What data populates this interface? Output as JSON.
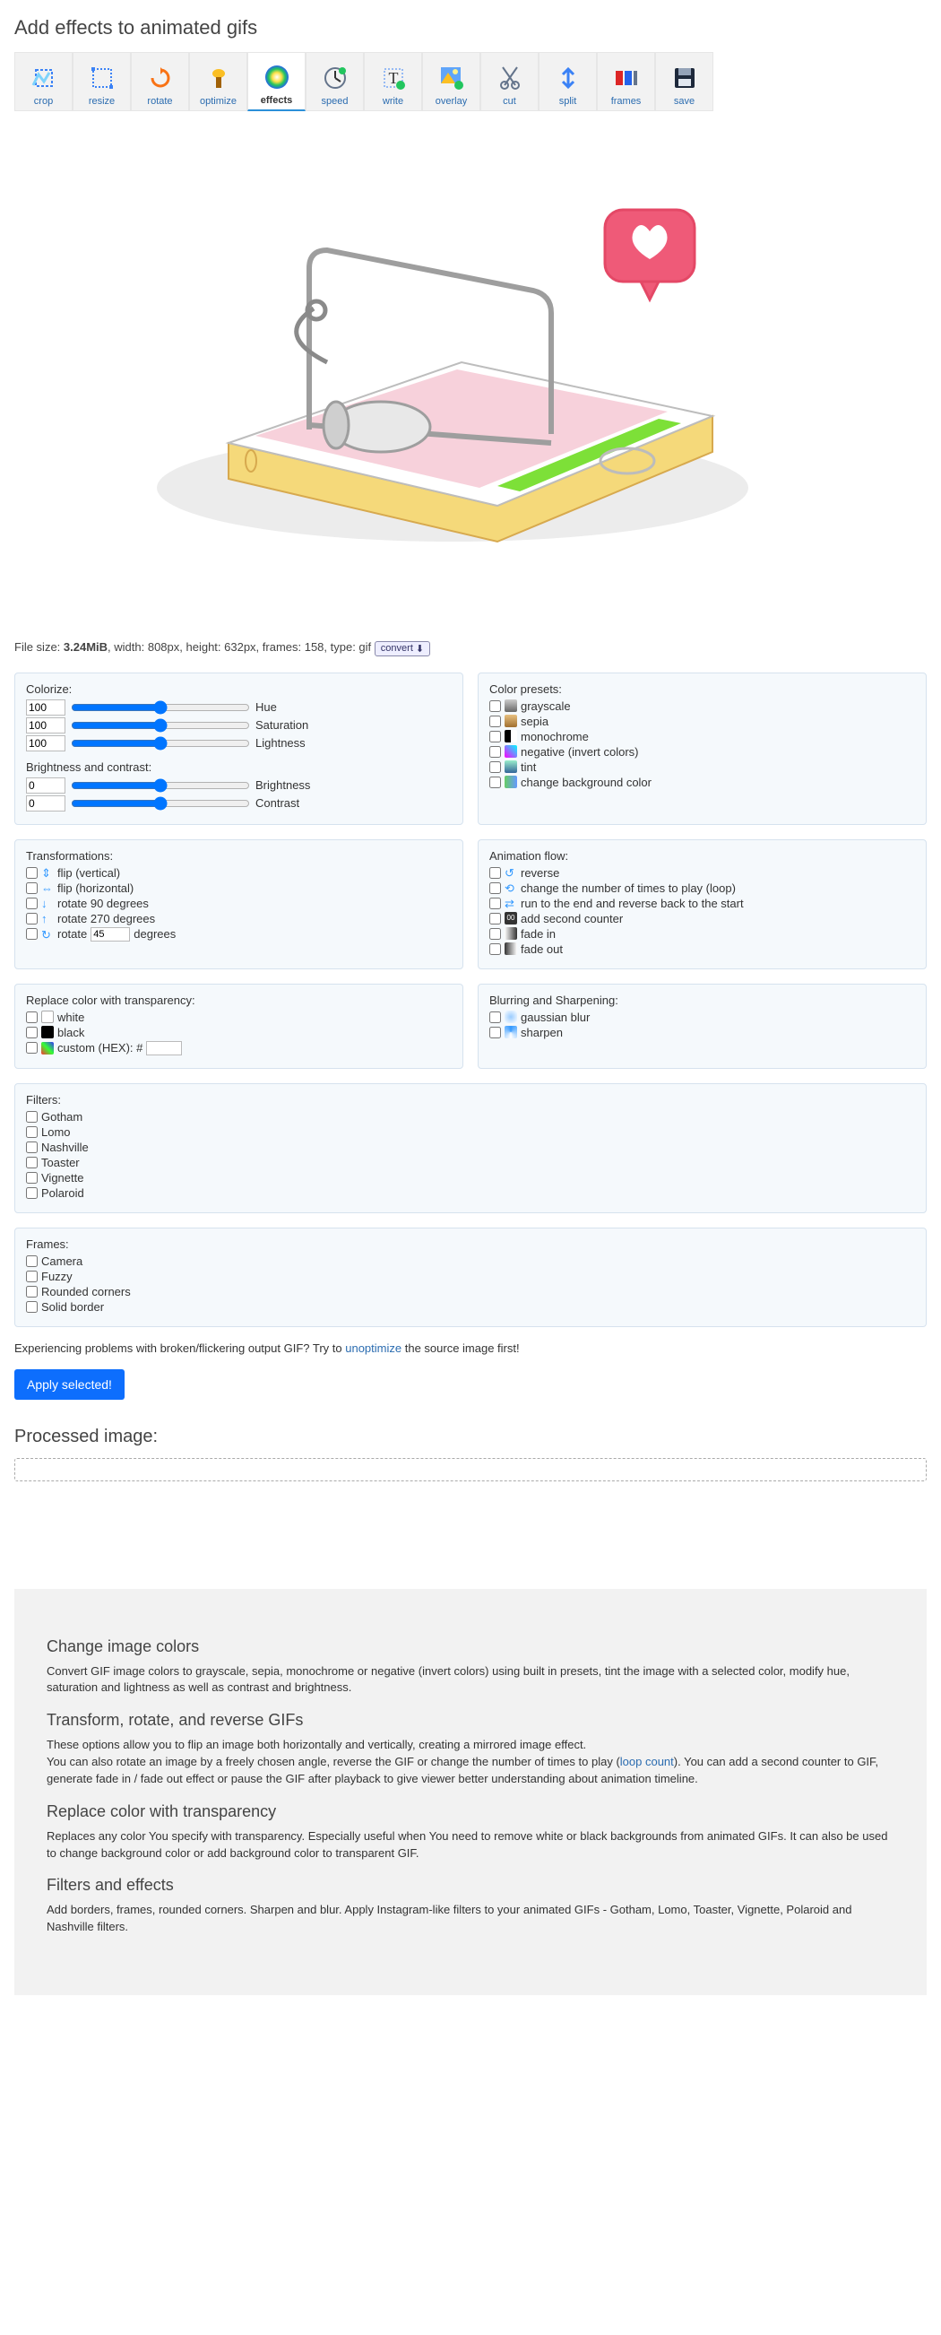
{
  "title": "Add effects to animated gifs",
  "toolbar": [
    {
      "key": "crop",
      "label": "crop"
    },
    {
      "key": "resize",
      "label": "resize"
    },
    {
      "key": "rotate",
      "label": "rotate"
    },
    {
      "key": "optimize",
      "label": "optimize"
    },
    {
      "key": "effects",
      "label": "effects",
      "active": true
    },
    {
      "key": "speed",
      "label": "speed"
    },
    {
      "key": "write",
      "label": "write"
    },
    {
      "key": "overlay",
      "label": "overlay"
    },
    {
      "key": "cut",
      "label": "cut"
    },
    {
      "key": "split",
      "label": "split"
    },
    {
      "key": "frames",
      "label": "frames"
    },
    {
      "key": "save",
      "label": "save"
    }
  ],
  "file_info": {
    "prefix": "File size: ",
    "size": "3.24MiB",
    "rest": ", width: 808px, height: 632px, frames: 158, type: gif",
    "convert": "convert"
  },
  "panels": {
    "colorize": {
      "title": "Colorize:",
      "hue_val": "100",
      "hue_label": "Hue",
      "sat_val": "100",
      "sat_label": "Saturation",
      "lig_val": "100",
      "lig_label": "Lightness",
      "bc_title": "Brightness and contrast:",
      "bri_val": "0",
      "bri_label": "Brightness",
      "con_val": "0",
      "con_label": "Contrast"
    },
    "presets": {
      "title": "Color presets:",
      "items": [
        "grayscale",
        "sepia",
        "monochrome",
        "negative (invert colors)",
        "tint",
        "change background color"
      ]
    },
    "transforms": {
      "title": "Transformations:",
      "flip_v": "flip (vertical)",
      "flip_h": "flip (horizontal)",
      "r90": "rotate 90 degrees",
      "r270": "rotate 270 degrees",
      "rotate_lbl": "rotate",
      "rotate_val": "45",
      "degrees": "degrees"
    },
    "flow": {
      "title": "Animation flow:",
      "items": [
        "reverse",
        "change the number of times to play (loop)",
        "run to the end and reverse back to the start",
        "add second counter",
        "fade in",
        "fade out"
      ]
    },
    "replace": {
      "title": "Replace color with transparency:",
      "white": "white",
      "black": "black",
      "custom_lbl": "custom (HEX): #",
      "custom_val": ""
    },
    "blur": {
      "title": "Blurring and Sharpening:",
      "items": [
        "gaussian blur",
        "sharpen"
      ]
    },
    "filters": {
      "title": "Filters:",
      "items": [
        "Gotham",
        "Lomo",
        "Nashville",
        "Toaster",
        "Vignette",
        "Polaroid"
      ]
    },
    "frames": {
      "title": "Frames:",
      "items": [
        "Camera",
        "Fuzzy",
        "Rounded corners",
        "Solid border"
      ]
    }
  },
  "hint": {
    "pre": "Experiencing problems with broken/flickering output GIF? Try to ",
    "link": "unoptimize",
    "post": " the source image first!"
  },
  "apply": "Apply selected!",
  "processed_title": "Processed image:",
  "help": {
    "h1": "Change image colors",
    "p1": "Convert GIF image colors to grayscale, sepia, monochrome or negative (invert colors) using built in presets, tint the image with a selected color, modify hue, saturation and lightness as well as contrast and brightness.",
    "h2": "Transform, rotate, and reverse GIFs",
    "p2a": "These options allow you to flip an image both horizontally and vertically, creating a mirrored image effect.",
    "p2b_pre": "You can also rotate an image by a freely chosen angle, reverse the GIF or change the number of times to play (",
    "p2b_link": "loop count",
    "p2b_post": "). You can add a second counter to GIF, generate fade in / fade out effect or pause the GIF after playback to give viewer better understanding about animation timeline.",
    "h3": "Replace color with transparency",
    "p3": "Replaces any color You specify with transparency. Especially useful when You need to remove white or black backgrounds from animated GIFs. It can also be used to change background color or add background color to transparent GIF.",
    "h4": "Filters and effects",
    "p4": "Add borders, frames, rounded corners. Sharpen and blur. Apply Instagram-like filters to your animated GIFs - Gotham, Lomo, Toaster, Vignette, Polaroid and Nashville filters."
  }
}
